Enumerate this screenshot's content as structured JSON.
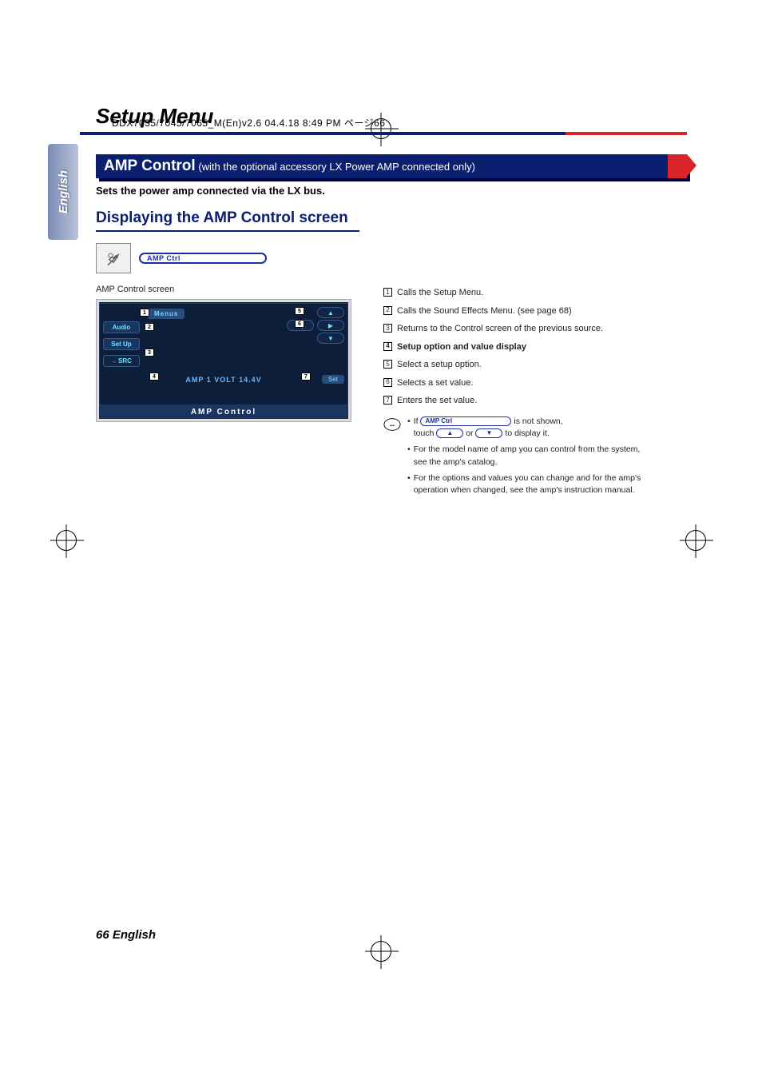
{
  "meta": {
    "header_line": "DDX7035/7045/7065_M(En)v2.6  04.4.18  8:49 PM  ページ66"
  },
  "chapter": "Setup Menu",
  "side_tab": "English",
  "banner": {
    "title": "AMP Control",
    "qualifier": "(with the optional accessory LX Power AMP connected only)"
  },
  "subtitle": "Sets the power amp connected via the LX bus.",
  "section_heading": "Displaying the AMP Control screen",
  "amp_pill_label": "AMP Ctrl",
  "screen_caption": "AMP Control screen",
  "device": {
    "menus": "Menus",
    "audio": "Audio",
    "setup": "Set Up",
    "src": "SRC",
    "value": "AMP 1 VOLT 14.4V",
    "set": "Set",
    "footer": "AMP Control"
  },
  "callouts": [
    {
      "n": "1",
      "text": "Calls the Setup Menu."
    },
    {
      "n": "2",
      "text": "Calls the Sound Effects Menu. (see page 68)"
    },
    {
      "n": "3",
      "text": "Returns to the Control screen of the previous source."
    },
    {
      "n": "4",
      "text": "Setup option and value display",
      "bold": true
    },
    {
      "n": "5",
      "text": "Select a setup option."
    },
    {
      "n": "6",
      "text": "Selects a set value."
    },
    {
      "n": "7",
      "text": "Enters the set value."
    }
  ],
  "notes": {
    "line1_prefix": "If",
    "line1_suffix": "is not shown,",
    "line2_prefix": "touch",
    "line2_mid": "or",
    "line2_suffix": "to display it.",
    "bullet2": "For the model name of amp you can control from the system, see the amp's catalog.",
    "bullet3": "For the options and values you can change and for the amp's operation when changed, see the amp's instruction manual."
  },
  "footer": "66 English"
}
